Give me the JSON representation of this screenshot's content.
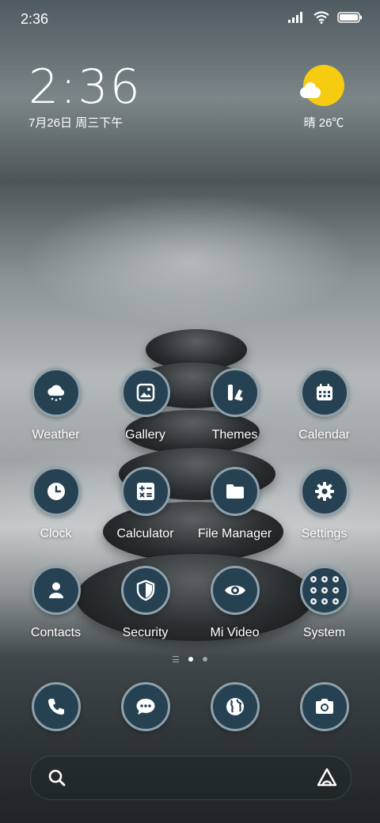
{
  "status_bar": {
    "time": "2:36",
    "icons": [
      "signal-icon",
      "wifi-icon",
      "battery-icon"
    ]
  },
  "clock_widget": {
    "time": "2:36",
    "date": "7月26日 周三下午"
  },
  "weather_widget": {
    "icon": "sun-cloud-icon",
    "text": "晴 26℃"
  },
  "apps": [
    {
      "label": "Weather",
      "icon": "weather-icon"
    },
    {
      "label": "Gallery",
      "icon": "gallery-icon"
    },
    {
      "label": "Themes",
      "icon": "themes-icon"
    },
    {
      "label": "Calendar",
      "icon": "calendar-icon"
    },
    {
      "label": "Clock",
      "icon": "clock-icon"
    },
    {
      "label": "Calculator",
      "icon": "calculator-icon"
    },
    {
      "label": "File Manager",
      "icon": "folder-icon"
    },
    {
      "label": "Settings",
      "icon": "gear-icon"
    },
    {
      "label": "Contacts",
      "icon": "contacts-icon"
    },
    {
      "label": "Security",
      "icon": "shield-icon"
    },
    {
      "label": "Mi Video",
      "icon": "eye-icon"
    },
    {
      "label": "System",
      "icon": "folder-grid-icon"
    }
  ],
  "page_indicator": {
    "pages": 2,
    "current": 1
  },
  "dock": [
    {
      "icon": "phone-icon"
    },
    {
      "icon": "messages-icon"
    },
    {
      "icon": "browser-icon"
    },
    {
      "icon": "camera-icon"
    }
  ],
  "colors": {
    "icon_bg": "#264152",
    "icon_ring": "#8fa1ab",
    "sun": "#f6cc10"
  }
}
